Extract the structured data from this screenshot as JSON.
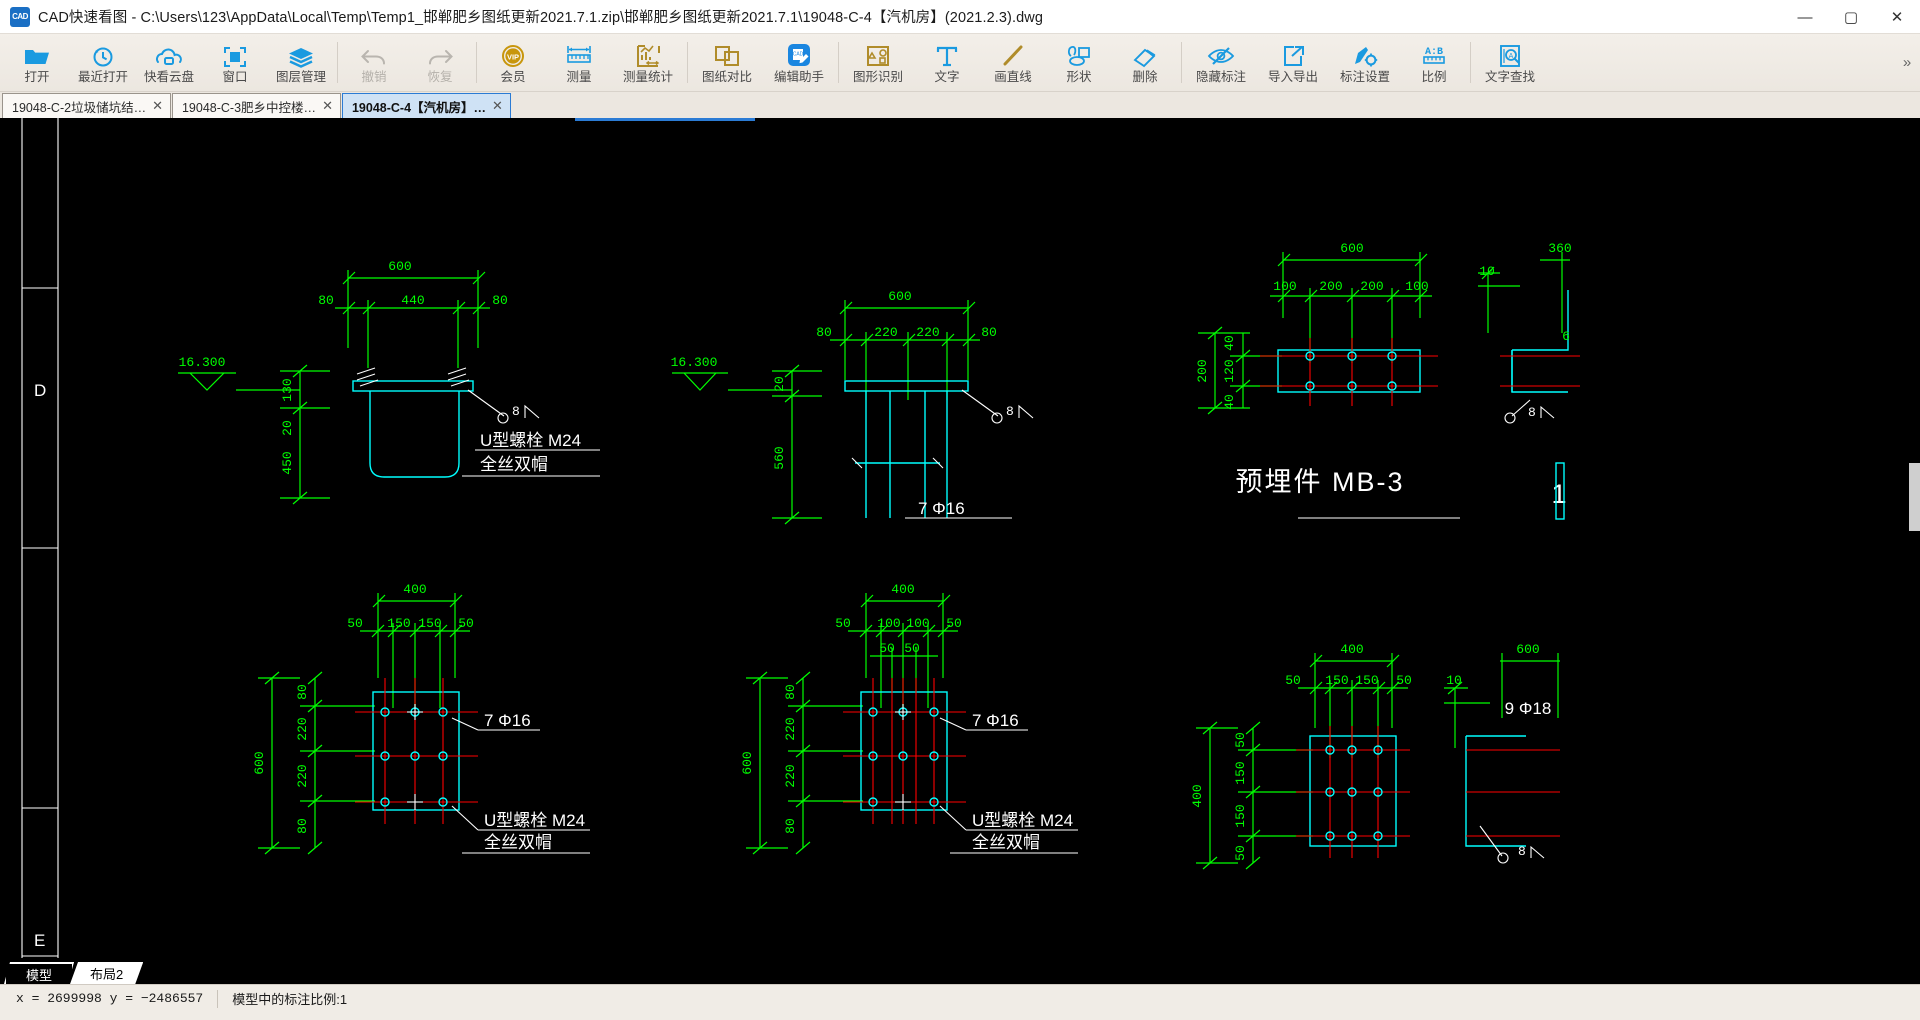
{
  "window": {
    "title": "CAD快速看图 - C:\\Users\\123\\AppData\\Local\\Temp\\Temp1_邯郸肥乡图纸更新2021.7.1.zip\\邯郸肥乡图纸更新2021.7.1\\19048-C-4【汽机房】(2021.2.3).dwg",
    "logo_text": "CAD",
    "minimize": "—",
    "maximize": "▢",
    "close": "✕"
  },
  "toolbar": {
    "overflow": "»",
    "items": [
      {
        "label": "打开",
        "icon": "folder-open-icon",
        "disabled": false
      },
      {
        "label": "最近打开",
        "icon": "recent-clock-icon",
        "disabled": false
      },
      {
        "label": "快看云盘",
        "icon": "cloud-icon",
        "disabled": false
      },
      {
        "label": "窗口",
        "icon": "window-frame-icon",
        "disabled": false
      },
      {
        "label": "图层管理",
        "icon": "layers-icon",
        "disabled": false
      },
      {
        "label": "撤销",
        "icon": "undo-arrow-icon",
        "disabled": true
      },
      {
        "label": "恢复",
        "icon": "redo-arrow-icon",
        "disabled": true
      },
      {
        "label": "会员",
        "icon": "vip-badge-icon",
        "disabled": false
      },
      {
        "label": "测量",
        "icon": "measure-ruler-icon",
        "disabled": false
      },
      {
        "label": "测量统计",
        "icon": "measure-stats-icon",
        "disabled": false
      },
      {
        "label": "图纸对比",
        "icon": "compare-sheets-icon",
        "disabled": false
      },
      {
        "label": "编辑助手",
        "icon": "cad-edit-icon",
        "disabled": false
      },
      {
        "label": "图形识别",
        "icon": "shape-recognize-icon",
        "disabled": false
      },
      {
        "label": "文字",
        "icon": "text-tool-icon",
        "disabled": false
      },
      {
        "label": "画直线",
        "icon": "draw-line-icon",
        "disabled": false
      },
      {
        "label": "形状",
        "icon": "shape-draw-icon",
        "disabled": false
      },
      {
        "label": "删除",
        "icon": "eraser-icon",
        "disabled": false
      },
      {
        "label": "隐藏标注",
        "icon": "hide-annotation-icon",
        "disabled": false
      },
      {
        "label": "导入导出",
        "icon": "import-export-icon",
        "disabled": false
      },
      {
        "label": "标注设置",
        "icon": "annotation-gear-icon",
        "disabled": false
      },
      {
        "label": "比例",
        "icon": "scale-ratio-icon",
        "disabled": false
      },
      {
        "label": "文字查找",
        "icon": "text-search-icon",
        "disabled": false
      }
    ],
    "separators_after": [
      4,
      6,
      9,
      11,
      16,
      20
    ]
  },
  "doc_tabs": [
    {
      "label": "19048-C-2垃圾储坑结…",
      "close": "✕",
      "active": false
    },
    {
      "label": "19048-C-3肥乡中控楼…",
      "close": "✕",
      "active": false
    },
    {
      "label": "19048-C-4【汽机房】…",
      "close": "✕",
      "active": true
    }
  ],
  "layout_tabs": [
    {
      "label": "模型",
      "active": true
    },
    {
      "label": "布局2",
      "active": false
    }
  ],
  "statusbar": {
    "coords": "x = 2699998  y = −2486557",
    "scale": "模型中的标注比例:1"
  },
  "colors": {
    "canvas_bg": "#000000",
    "dim_green": "#00ff00",
    "geom_cyan": "#00ffff",
    "hatch_red": "#ff0000",
    "text_white": "#ffffff",
    "accent_blue": "#2b7bd4",
    "vip_gold": "#b8860b"
  },
  "drawing": {
    "title_block": "预埋件  MB-3",
    "details": [
      {
        "id": "detail-1-elevation",
        "dims_top": [
          "600",
          "80",
          "440",
          "80"
        ],
        "dims_left": [
          "130",
          "20",
          "450"
        ],
        "elevation": "16.300",
        "weld": "8",
        "notes": [
          "U型螺栓  M24",
          "全丝双帽"
        ]
      },
      {
        "id": "detail-2-elevation",
        "dims_top": [
          "600",
          "80",
          "220",
          "220",
          "80"
        ],
        "dims_left": [
          "20",
          "560"
        ],
        "elevation": "16.300",
        "weld": "8",
        "notes": [
          "7 Φ16"
        ]
      },
      {
        "id": "detail-3-plan-right",
        "dims_top": [
          "600",
          "100",
          "200",
          "200",
          "100"
        ],
        "dims_left": [
          "200",
          "40",
          "120",
          "40"
        ],
        "dims_far": [
          "10",
          "360"
        ],
        "weld": "8",
        "notes": [
          "6"
        ]
      },
      {
        "id": "detail-4-plan",
        "dims_top": [
          "400",
          "50",
          "150",
          "150",
          "50"
        ],
        "dims_left": [
          "600",
          "80",
          "220",
          "220",
          "80"
        ],
        "notes": [
          "7 Φ16",
          "U型螺栓  M24",
          "全丝双帽"
        ]
      },
      {
        "id": "detail-5-plan",
        "dims_top": [
          "400",
          "50",
          "100",
          "100",
          "50",
          "50",
          "50"
        ],
        "dims_left": [
          "600",
          "80",
          "220",
          "220",
          "80"
        ],
        "notes": [
          "7 Φ16",
          "U型螺栓  M24",
          "全丝双帽"
        ]
      },
      {
        "id": "detail-6-plan-right",
        "dims_top": [
          "400",
          "50",
          "150",
          "150",
          "50"
        ],
        "dims_left": [
          "400",
          "50",
          "150",
          "150",
          "50"
        ],
        "dims_far": [
          "10",
          "600"
        ],
        "weld": "8",
        "notes": [
          "9 Φ18"
        ]
      }
    ]
  }
}
